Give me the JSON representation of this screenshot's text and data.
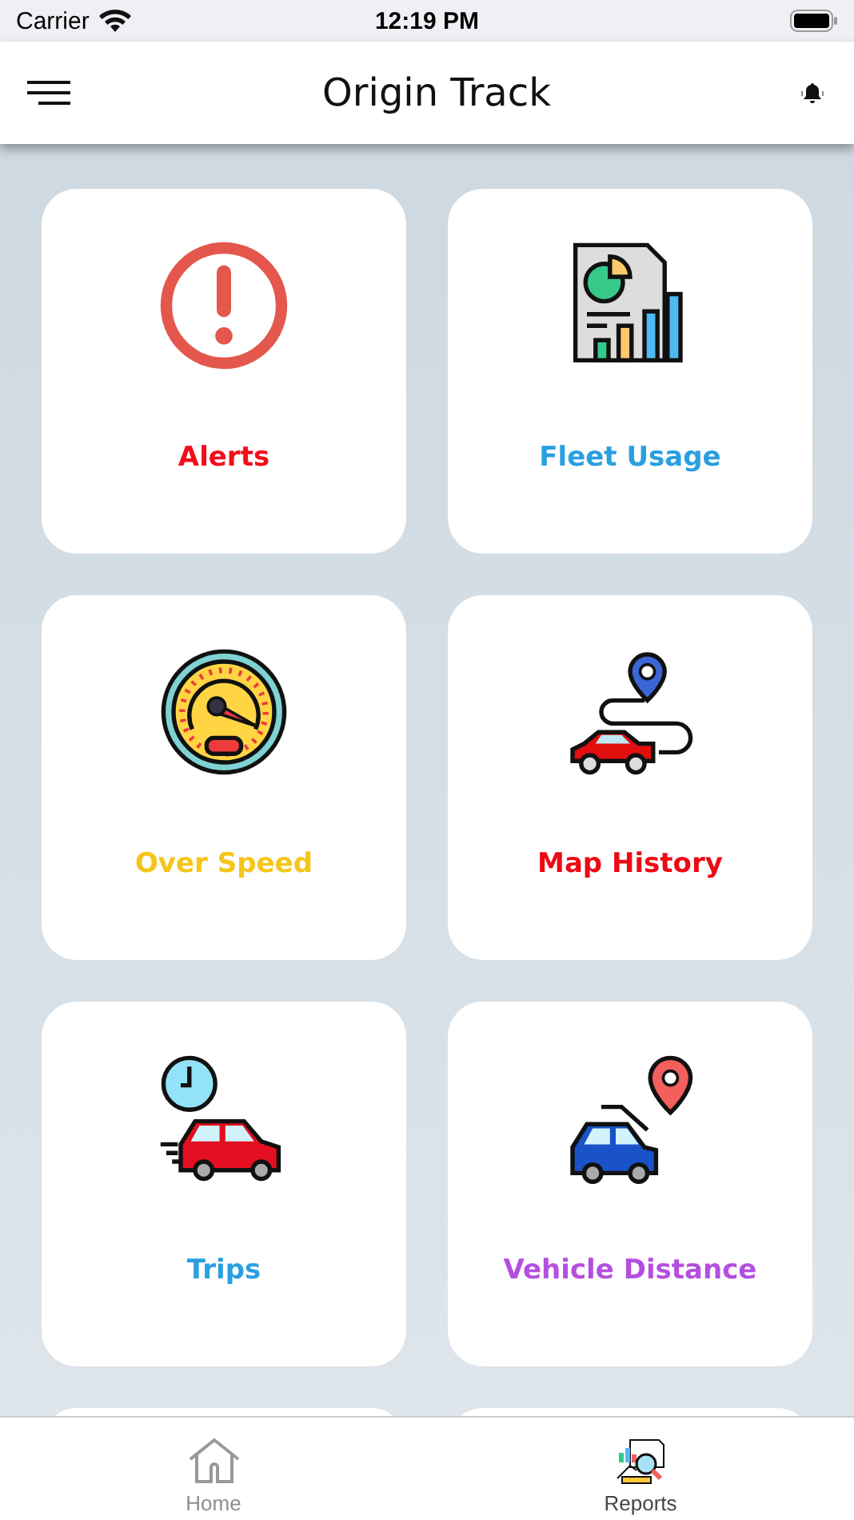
{
  "status_bar": {
    "carrier": "Carrier",
    "time": "12:19 PM"
  },
  "header": {
    "title": "Origin Track"
  },
  "tiles": [
    {
      "kind": "alert",
      "label": "Alerts",
      "color": "#f30d1a"
    },
    {
      "kind": "report",
      "label": "Fleet Usage",
      "color": "#2a9fe0"
    },
    {
      "kind": "speed",
      "label": "Over Speed",
      "color": "#f5c518"
    },
    {
      "kind": "route",
      "label": "Map History",
      "color": "#ec0a14"
    },
    {
      "kind": "trip",
      "label": "Trips",
      "color": "#2a9fe0"
    },
    {
      "kind": "distance",
      "label": "Vehicle Distance",
      "color": "#b44fe0"
    }
  ],
  "tab_bar": [
    {
      "kind": "home",
      "label": "Home",
      "selected": false
    },
    {
      "kind": "reports",
      "label": "Reports",
      "selected": true
    }
  ]
}
